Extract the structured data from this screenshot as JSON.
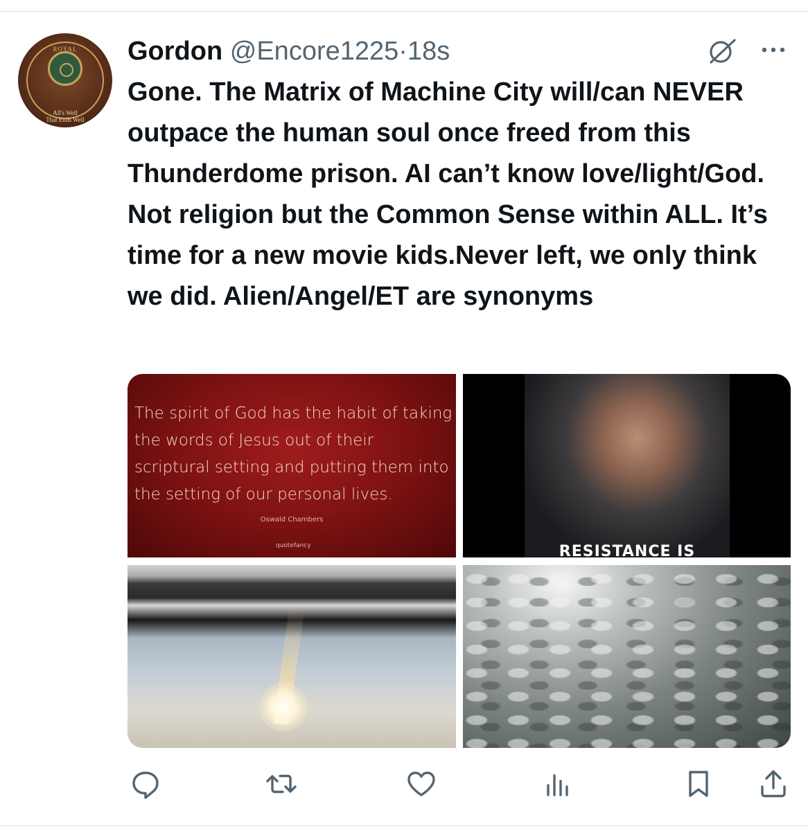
{
  "tweet": {
    "author_name": "Gordon",
    "author_handle": "@Encore1225",
    "separator": "·",
    "timestamp": "18s",
    "text": "Gone. The Matrix of Machine City will/can NEVER outpace the human soul once freed from this Thunderdome prison. AI can’t know love/light/God. Not religion but the Common Sense within ALL. It’s time for a new movie kids.Never left, we only think we did. Alien/Angel/ET are synonyms"
  },
  "avatar": {
    "top_text": "ROYAL",
    "motto_line1": "All's Well",
    "motto_line2": "That Ends Well"
  },
  "media": {
    "quote_text": "The spirit of God has the habit of taking the words of Jesus out of their scriptural setting and putting them into the setting of our personal lives.",
    "quote_author": "Oswald Chambers",
    "quote_brand": "quotefancy",
    "borg_caption": "RESISTANCE IS FUTILE"
  },
  "icons": {
    "grok": "grok-icon",
    "more": "more-icon",
    "reply": "reply-icon",
    "retweet": "retweet-icon",
    "like": "like-icon",
    "views": "views-icon",
    "bookmark": "bookmark-icon",
    "share": "share-icon"
  },
  "colors": {
    "text": "#0f1419",
    "secondary": "#536471",
    "divider": "#dcdfe2"
  }
}
